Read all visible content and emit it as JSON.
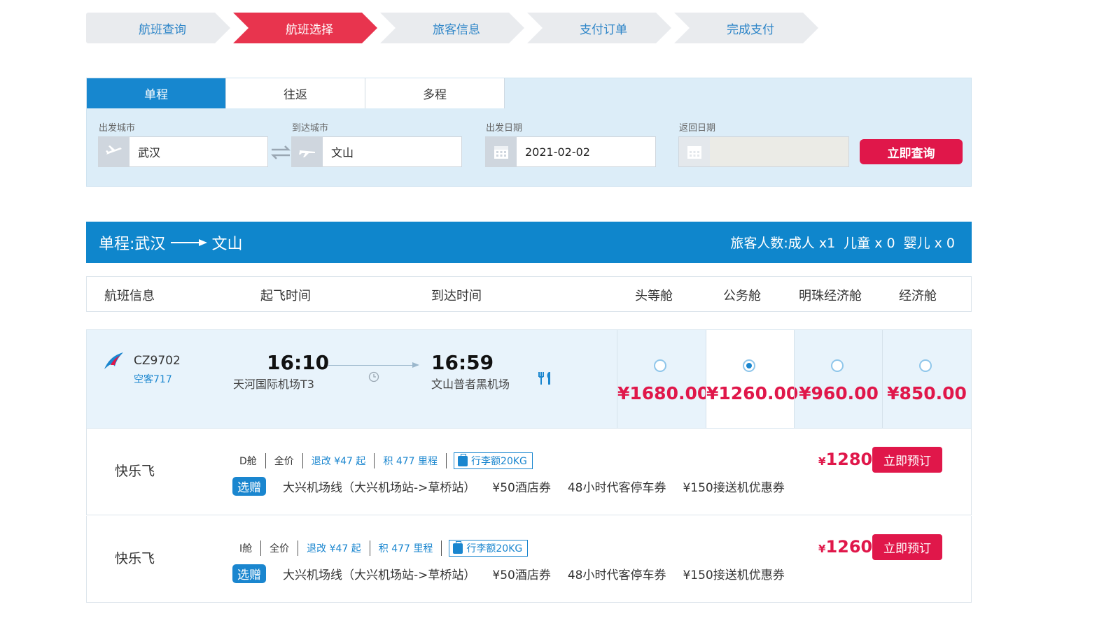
{
  "steps": [
    "航班查询",
    "航班选择",
    "旅客信息",
    "支付订单",
    "完成支付"
  ],
  "search": {
    "tabs": [
      "单程",
      "往返",
      "多程"
    ],
    "labels": {
      "from": "出发城市",
      "to": "到达城市",
      "depart": "出发日期",
      "return": "返回日期"
    },
    "values": {
      "from": "武汉",
      "to": "文山",
      "depart": "2021-02-02",
      "return": ""
    },
    "button": "立即查询"
  },
  "route": {
    "prefix": "单程:",
    "from": "武汉",
    "to": "文山",
    "passengers_label": "旅客人数:",
    "adult": "成人 x1",
    "child": "儿童 x 0",
    "infant": "婴儿 x 0"
  },
  "columns": [
    "航班信息",
    "起飞时间",
    "到达时间",
    "头等舱",
    "公务舱",
    "明珠经济舱",
    "经济舱"
  ],
  "flight": {
    "number": "CZ9702",
    "aircraft": "空客717",
    "depart_time": "16:10",
    "depart_airport": "天河国际机场T3",
    "arrive_time": "16:59",
    "arrive_airport": "文山普者黑机场",
    "cabins": [
      {
        "price": "¥1680.00",
        "selected": false
      },
      {
        "price": "¥1260.00",
        "selected": true
      },
      {
        "price": "¥960.00",
        "selected": false
      },
      {
        "price": "¥850.00",
        "selected": false
      }
    ]
  },
  "fares": [
    {
      "product": "快乐飞",
      "cabin": "D舱",
      "fare_type": "全价",
      "change": "退改 ¥47 起",
      "miles": "积 477 里程",
      "baggage": "行李额20KG",
      "gift_badge": "选赠",
      "gifts": [
        "大兴机场线（大兴机场站->草桥站）",
        "¥50酒店券",
        "48小时代客停车券",
        "¥150接送机优惠券"
      ],
      "currency": "¥",
      "price": "1280",
      "button": "立即预订"
    },
    {
      "product": "快乐飞",
      "cabin": "I舱",
      "fare_type": "全价",
      "change": "退改 ¥47 起",
      "miles": "积 477 里程",
      "baggage": "行李额20KG",
      "gift_badge": "选赠",
      "gifts": [
        "大兴机场线（大兴机场站->草桥站）",
        "¥50酒店券",
        "48小时代客停车券",
        "¥150接送机优惠券"
      ],
      "currency": "¥",
      "price": "1260",
      "button": "立即预订"
    }
  ],
  "colors": {
    "accent": "#1787cf",
    "active_step": "#e8344e",
    "price": "#e0174a"
  },
  "icons": [
    "plane-takeoff-icon",
    "plane-landing-icon",
    "swap-icon",
    "calendar-icon",
    "airline-logo-icon",
    "clock-icon",
    "meal-icon",
    "luggage-icon"
  ]
}
